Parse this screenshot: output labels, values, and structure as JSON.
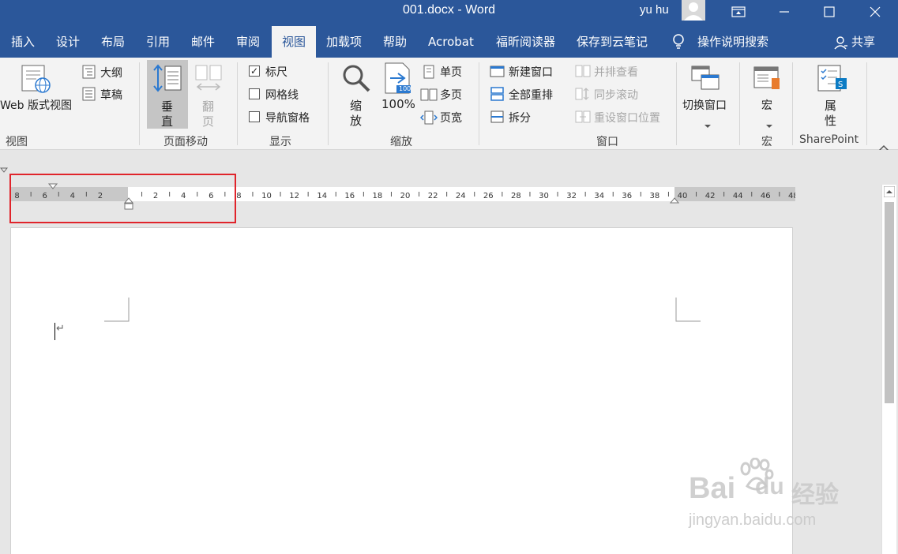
{
  "window": {
    "title": "001.docx  -  Word",
    "user": "yu hu"
  },
  "tabs": [
    {
      "label": "插入"
    },
    {
      "label": "设计"
    },
    {
      "label": "布局"
    },
    {
      "label": "引用"
    },
    {
      "label": "邮件"
    },
    {
      "label": "审阅"
    },
    {
      "label": "视图"
    },
    {
      "label": "加载项"
    },
    {
      "label": "帮助"
    },
    {
      "label": "Acrobat"
    },
    {
      "label": "福昕阅读器"
    },
    {
      "label": "保存到云笔记"
    },
    {
      "label": "操作说明搜索"
    }
  ],
  "active_tab": "视图",
  "share_label": "共享",
  "ribbon": {
    "view_group": {
      "label": "视图",
      "web_layout": "Web 版式视图",
      "outline": "大纲",
      "draft": "草稿"
    },
    "page_movement": {
      "label": "页面移动",
      "vertical": [
        "垂",
        "直"
      ],
      "side_to_side": [
        "翻",
        "页"
      ]
    },
    "show": {
      "label": "显示",
      "ruler": "标尺",
      "ruler_checked": true,
      "gridlines": "网格线",
      "gridlines_checked": false,
      "nav_pane": "导航窗格",
      "nav_pane_checked": false
    },
    "zoom": {
      "label": "缩放",
      "zoom": [
        "缩",
        "放"
      ],
      "hundred": "100%",
      "one_page": "单页",
      "multiple_pages": "多页",
      "page_width": "页宽",
      "icon_text": "100"
    },
    "window": {
      "label": "窗口",
      "new_window": "新建窗口",
      "arrange_all": "全部重排",
      "split": "拆分",
      "view_side_by_side": "并排查看",
      "sync_scroll": "同步滚动",
      "reset_window": "重设窗口位置",
      "switch_windows": "切换窗口"
    },
    "macros": {
      "label": "宏",
      "macros": "宏"
    },
    "sharepoint": {
      "label": "SharePoint",
      "properties": [
        "属",
        "性"
      ]
    }
  },
  "ruler": {
    "left_labels": [
      "8",
      "6",
      "4",
      "2"
    ],
    "body_labels": [
      "2",
      "4",
      "6",
      "8",
      "10",
      "12",
      "14",
      "16",
      "18",
      "20",
      "22",
      "24",
      "26",
      "28",
      "30",
      "32",
      "34",
      "36",
      "38",
      "40",
      "42",
      "44",
      "46",
      "48"
    ]
  },
  "watermark": {
    "brand": "Bai",
    "brand_end": "du",
    "cn": "经验",
    "url": "jingyan.baidu.com"
  },
  "colors": {
    "title_bar": "#2b579a",
    "ribbon": "#f3f3f3",
    "highlight_box": "#e0242b"
  }
}
